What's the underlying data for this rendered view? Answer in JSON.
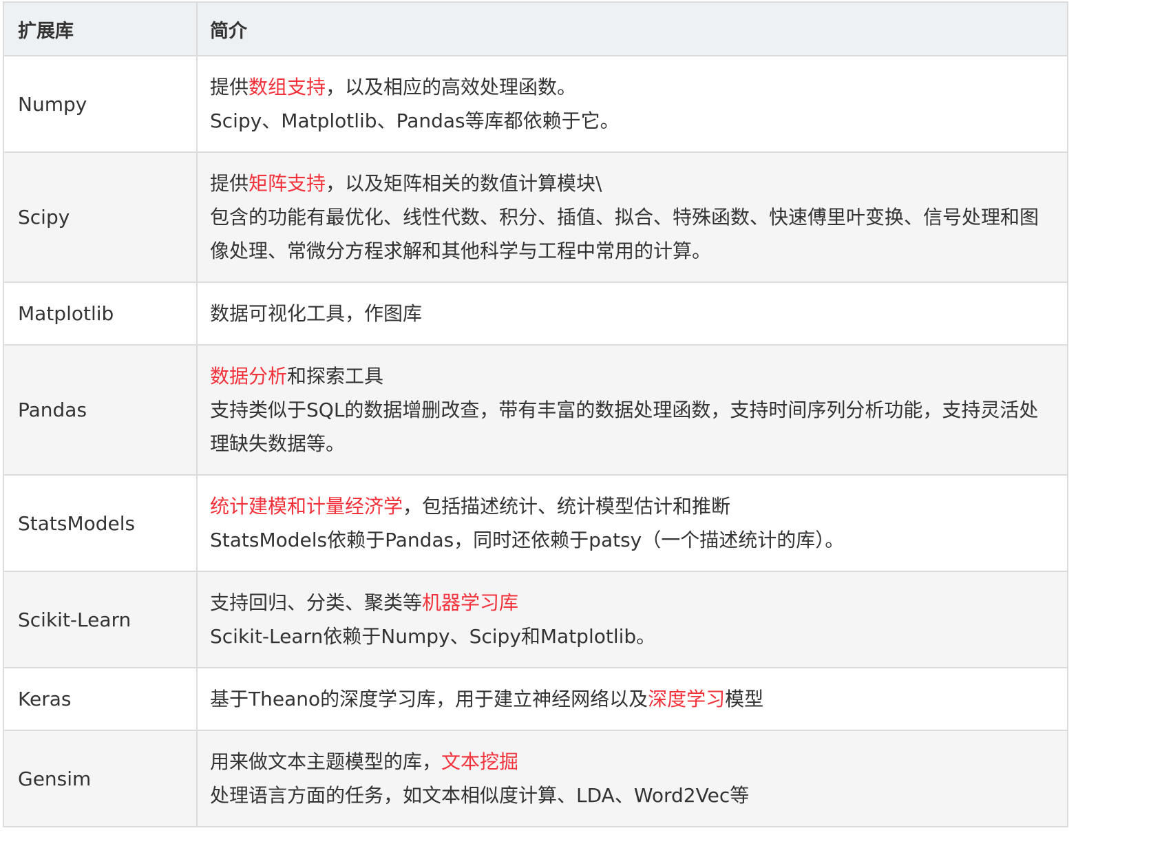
{
  "table": {
    "headers": [
      "扩展库",
      "简介"
    ],
    "rows": [
      {
        "name": "Numpy",
        "lines": [
          [
            {
              "t": "提供"
            },
            {
              "t": "数组支持",
              "hl": true
            },
            {
              "t": "，以及相应的高效处理函数。"
            }
          ],
          [
            {
              "t": "Scipy、Matplotlib、Pandas等库都依赖于它。"
            }
          ]
        ]
      },
      {
        "name": "Scipy",
        "lines": [
          [
            {
              "t": "提供"
            },
            {
              "t": "矩阵支持",
              "hl": true
            },
            {
              "t": "，以及矩阵相关的数值计算模块\\"
            }
          ],
          [
            {
              "t": "包含的功能有最优化、线性代数、积分、插值、拟合、特殊函数、快速傅里叶变换、信号处理和图像处理、常微分方程求解和其他科学与工程中常用的计算。"
            }
          ]
        ]
      },
      {
        "name": "Matplotlib",
        "lines": [
          [
            {
              "t": "数据可视化工具，作图库"
            }
          ]
        ]
      },
      {
        "name": "Pandas",
        "lines": [
          [
            {
              "t": "数据分析",
              "hl": true
            },
            {
              "t": "和探索工具"
            }
          ],
          [
            {
              "t": "支持类似于SQL的数据增删改查，带有丰富的数据处理函数，支持时间序列分析功能，支持灵活处理缺失数据等。"
            }
          ]
        ]
      },
      {
        "name": "StatsModels",
        "lines": [
          [
            {
              "t": "统计建模和计量经济学",
              "hl": true
            },
            {
              "t": "，包括描述统计、统计模型估计和推断"
            }
          ],
          [
            {
              "t": "StatsModels依赖于Pandas，同时还依赖于patsy（一个描述统计的库）。"
            }
          ]
        ]
      },
      {
        "name": "Scikit-Learn",
        "lines": [
          [
            {
              "t": "支持回归、分类、聚类等"
            },
            {
              "t": "机器学习库",
              "hl": true
            }
          ],
          [
            {
              "t": "Scikit-Learn依赖于Numpy、Scipy和Matplotlib。"
            }
          ]
        ]
      },
      {
        "name": "Keras",
        "lines": [
          [
            {
              "t": "基于Theano的深度学习库，用于建立神经网络以及"
            },
            {
              "t": "深度学习",
              "hl": true
            },
            {
              "t": "模型"
            }
          ]
        ]
      },
      {
        "name": "Gensim",
        "lines": [
          [
            {
              "t": "用来做文本主题模型的库，"
            },
            {
              "t": "文本挖掘",
              "hl": true
            }
          ],
          [
            {
              "t": "处理语言方面的任务，如文本相似度计算、LDA、Word2Vec等"
            }
          ]
        ]
      }
    ]
  },
  "colors": {
    "highlight": "#f2313b",
    "text": "#333333",
    "header_bg": "#eef1f3",
    "stripe_bg": "#f5f5f5",
    "border": "#dcdcdc"
  }
}
